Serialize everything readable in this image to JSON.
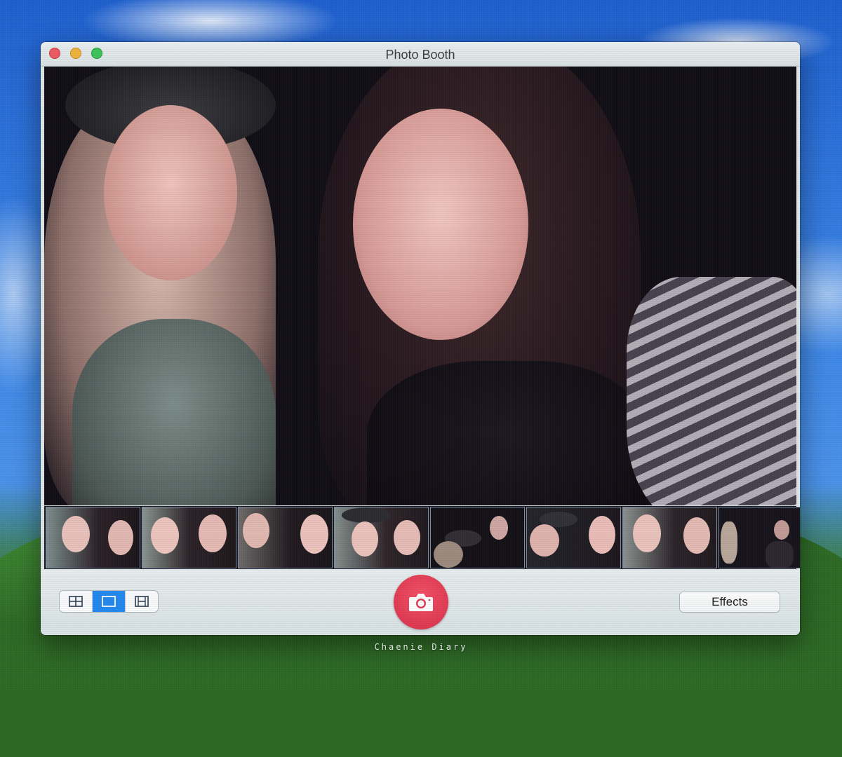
{
  "window": {
    "title": "Photo Booth"
  },
  "toolbar": {
    "layout_modes": [
      {
        "name": "grid",
        "icon": "grid-icon",
        "active": false
      },
      {
        "name": "single",
        "icon": "single-photo-icon",
        "active": true
      },
      {
        "name": "movie",
        "icon": "film-icon",
        "active": false
      }
    ],
    "shutter_icon": "camera-icon",
    "effects_label": "Effects"
  },
  "filmstrip": {
    "thumbnail_count": 8
  },
  "watermark": {
    "text": "Chaenie Diary"
  },
  "colors": {
    "shutter": "#e03a52",
    "active_segment": "#2288f0",
    "toolbar_bg": "#dfe7e8"
  }
}
